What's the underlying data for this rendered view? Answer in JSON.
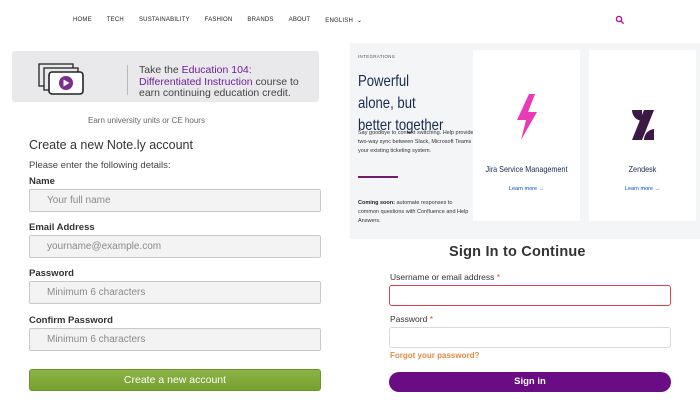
{
  "nav": {
    "items": [
      "HOME",
      "TECH",
      "SUSTAINABILITY",
      "FASHION",
      "BRANDS",
      "ABOUT"
    ],
    "language": "ENGLISH",
    "accent": "#b5179e"
  },
  "promo": {
    "line_prefix": "Take the ",
    "highlight": "Education 104: Differentiated Instruction",
    "line_suffix": " course to earn continuing education credit.",
    "subtext": "Earn university units or CE hours",
    "highlight_color": "#6d1f9b"
  },
  "signup": {
    "title": "Create a new Note.ly account",
    "description": "Please enter the following details:",
    "fields": {
      "name": {
        "label": "Name",
        "placeholder": "Your full name"
      },
      "email": {
        "label": "Email Address",
        "placeholder": "yourname@example.com"
      },
      "password": {
        "label": "Password",
        "placeholder": "Minimum 6 characters"
      },
      "confirm": {
        "label": "Confirm Password",
        "placeholder": "Minimum 6 characters"
      }
    },
    "submit_label": "Create a new account",
    "button_color": "#7ea83a"
  },
  "integrations": {
    "tag": "INTEGRATIONS",
    "heading": "Powerful alone, but better together",
    "body": "Say goodbye to context switching. Help provides a two-way sync between Slack, Microsoft Teams and your existing ticketing system.",
    "soon_label": "Coming soon:",
    "soon_text": " automate responses to common questions with Confluence and Help Answers.",
    "cards": [
      {
        "name": "Jira Service Management",
        "link": "Learn more →",
        "icon": "lightning-bolt-icon",
        "color": "#e83bb5"
      },
      {
        "name": "Zendesk",
        "link": "Learn more →",
        "icon": "zendesk-logo-icon",
        "color": "#3d1a45"
      }
    ]
  },
  "signin": {
    "title": "Sign In to Continue",
    "username_label": "Username or email address",
    "password_label": "Password",
    "required_mark": "*",
    "username_value": "",
    "forgot_label": "Forgot your password?",
    "button_label": "Sign in",
    "button_color": "#6a0d84"
  }
}
